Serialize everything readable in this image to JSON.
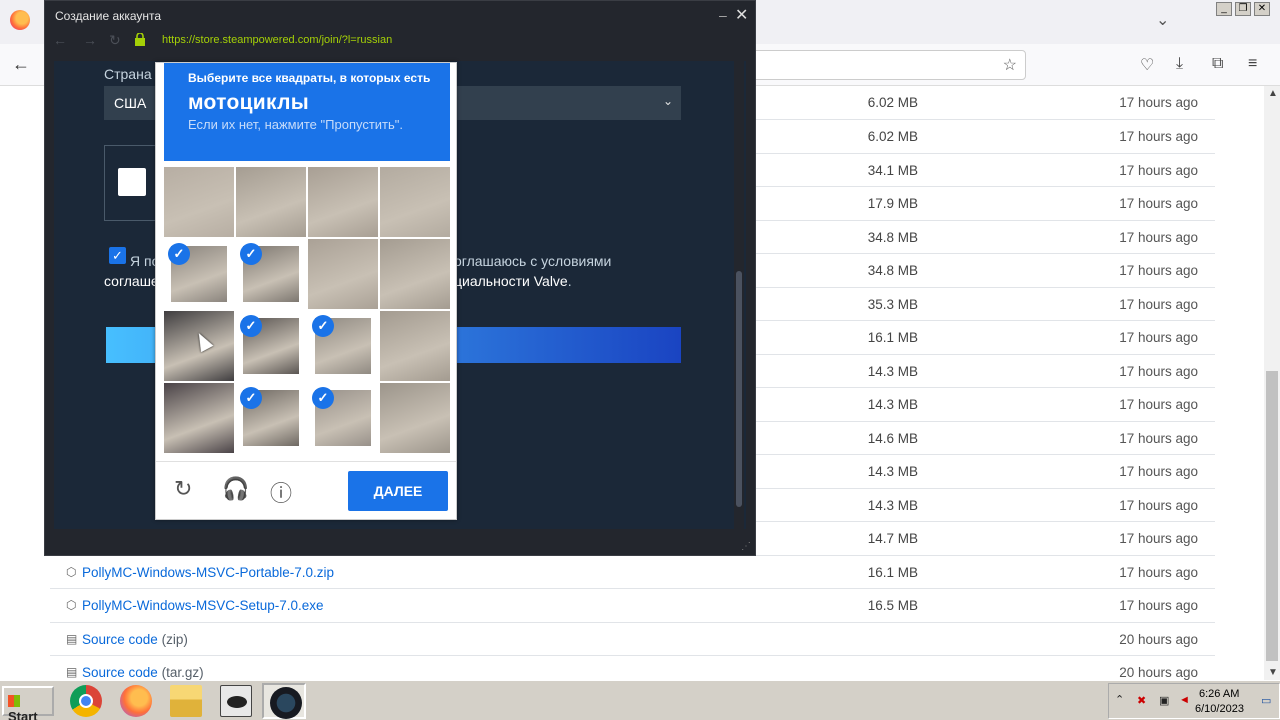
{
  "firefox": {
    "tab_list_glyph": "⌄",
    "back_glyph": "←",
    "toolbar_icons": [
      "pocket-icon",
      "download-icon",
      "extensions-icon",
      "menu-icon"
    ]
  },
  "assets": {
    "rows": [
      {
        "name": "",
        "size": "6.02 MB",
        "time": "17 hours ago"
      },
      {
        "name": "",
        "size": "6.02 MB",
        "time": "17 hours ago"
      },
      {
        "name": "",
        "size": "34.1 MB",
        "time": "17 hours ago"
      },
      {
        "name": "",
        "size": "17.9 MB",
        "time": "17 hours ago"
      },
      {
        "name": "",
        "size": "34.8 MB",
        "time": "17 hours ago"
      },
      {
        "name": "",
        "size": "34.8 MB",
        "time": "17 hours ago"
      },
      {
        "name": "",
        "size": "35.3 MB",
        "time": "17 hours ago"
      },
      {
        "name": "",
        "size": "16.1 MB",
        "time": "17 hours ago"
      },
      {
        "name": "",
        "size": "14.3 MB",
        "time": "17 hours ago"
      },
      {
        "name": "",
        "size": "14.3 MB",
        "time": "17 hours ago"
      },
      {
        "name": "",
        "size": "14.6 MB",
        "time": "17 hours ago"
      },
      {
        "name": "",
        "size": "14.3 MB",
        "time": "17 hours ago"
      },
      {
        "name": "",
        "size": "14.3 MB",
        "time": "17 hours ago"
      },
      {
        "name": "",
        "size": "14.7 MB",
        "time": "17 hours ago"
      },
      {
        "name": "PollyMC-Windows-MSVC-Portable-7.0.zip",
        "size": "16.1 MB",
        "time": "17 hours ago"
      },
      {
        "name": "PollyMC-Windows-MSVC-Setup-7.0.exe",
        "size": "16.5 MB",
        "time": "17 hours ago"
      },
      {
        "name": "Source code",
        "ext": "(zip)",
        "size": "",
        "time": "20 hours ago"
      },
      {
        "name": "Source code",
        "ext": "(tar.gz)",
        "size": "",
        "time": "20 hours ago"
      }
    ]
  },
  "steam": {
    "window_title": "Создание аккаунта",
    "url": "https://store.steampowered.com/join/?l=russian",
    "country_label": "Страна",
    "country_value": "США",
    "agree_line1a": "Я по",
    "agree_line1b": "оглашаюсь с условиями",
    "agree_line2a": "соглаше",
    "agree_line2b": "циальности Valve",
    "agree_line2c": "."
  },
  "recaptcha": {
    "instruction": "Выберите все квадраты, в которых есть",
    "target": "мотоциклы",
    "skip_hint": "Если их нет, нажмите \"Пропустить\".",
    "next_label": "ДАЛЕЕ",
    "selected_tiles": [
      4,
      5,
      9,
      10,
      13,
      14
    ],
    "tick_glyph": "✓"
  },
  "taskbar": {
    "start_label": "Start",
    "apps": [
      "chrome-icon",
      "firefox-icon",
      "explorer-icon",
      "app-eye-icon",
      "steam-icon"
    ],
    "clock_time": "6:26 AM",
    "clock_date": "6/10/2023"
  }
}
